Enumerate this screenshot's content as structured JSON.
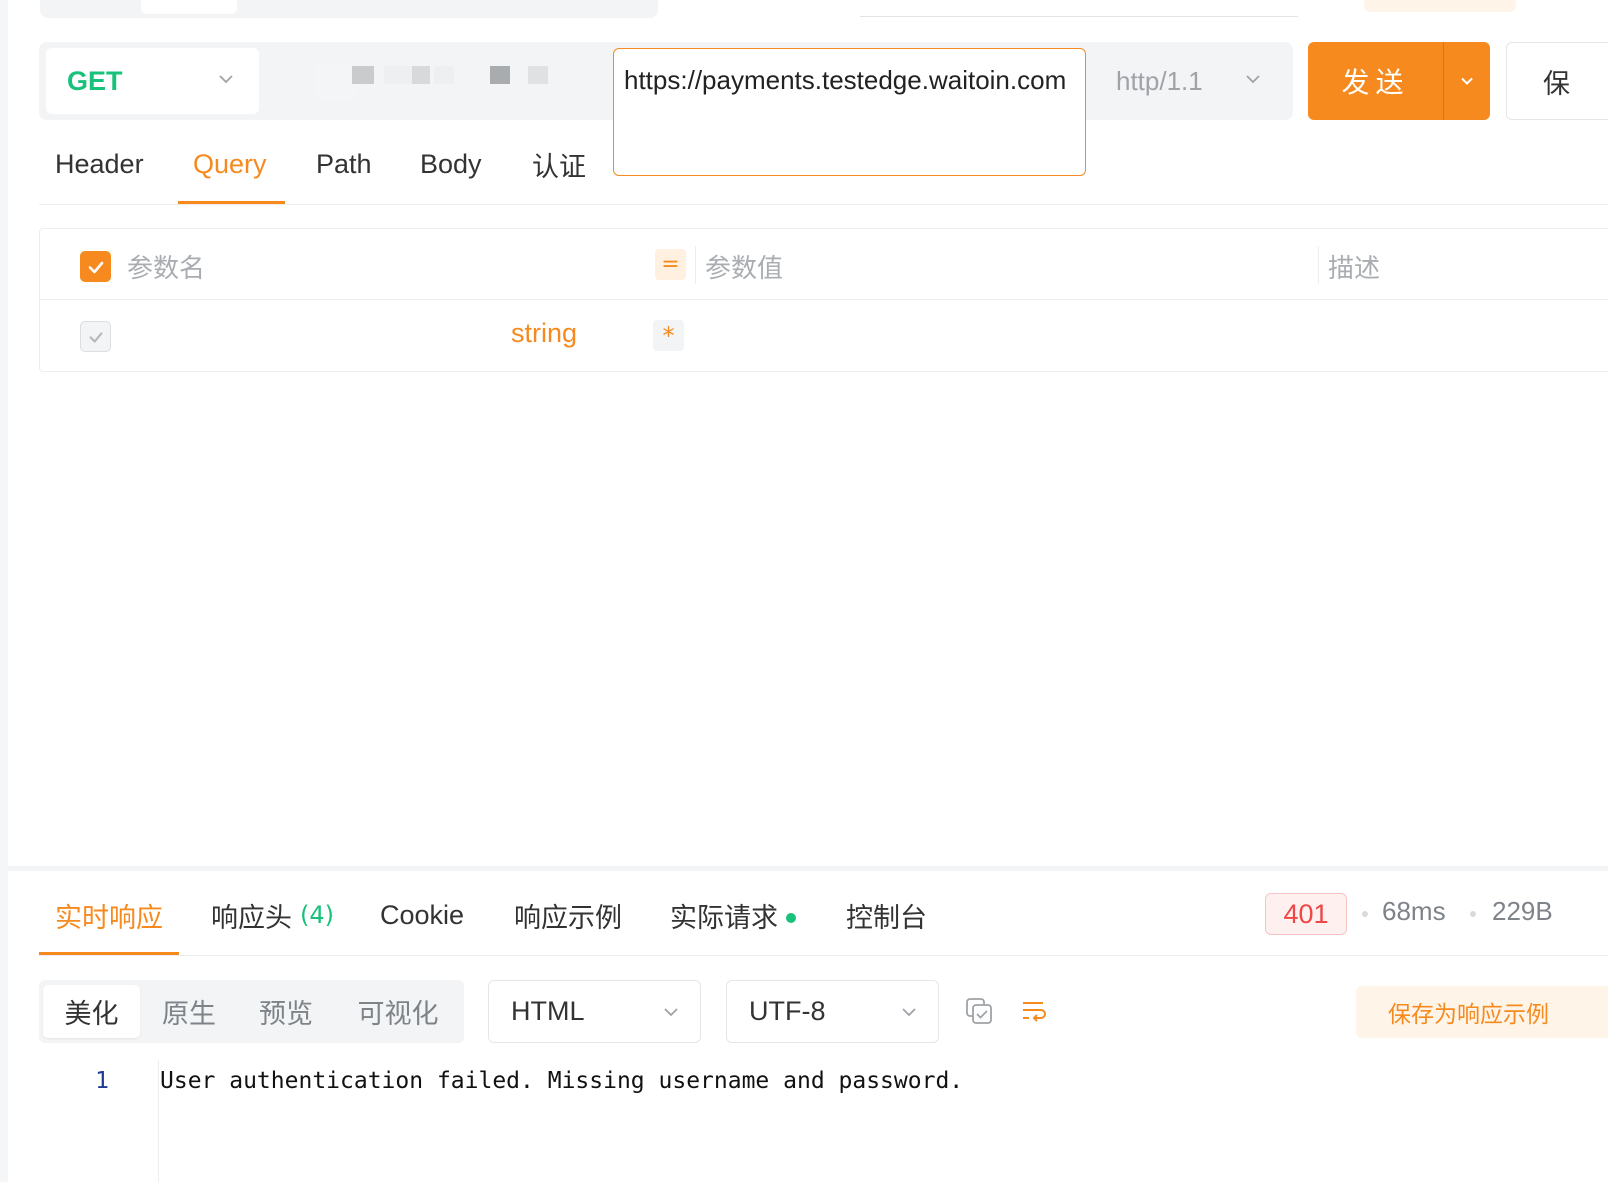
{
  "request": {
    "method": "GET",
    "url": "https://payments.testedge.waitoin.com",
    "protocol": "http/1.1",
    "send_label": "发送",
    "save_label": "保"
  },
  "request_tabs": [
    {
      "label": "Header",
      "active": false
    },
    {
      "label": "Query",
      "active": true
    },
    {
      "label": "Path",
      "active": false
    },
    {
      "label": "Body",
      "active": false
    },
    {
      "label": "认证",
      "active": false
    }
  ],
  "params": {
    "headers": {
      "name": "参数名",
      "equals": "=",
      "value": "参数值",
      "description": "描述"
    },
    "row": {
      "type": "string",
      "required_mark": "*"
    }
  },
  "response": {
    "tabs": [
      {
        "label": "实时响应",
        "active": true
      },
      {
        "label": "响应头",
        "count": "(4)"
      },
      {
        "label": "Cookie"
      },
      {
        "label": "响应示例"
      },
      {
        "label": "实际请求",
        "dot": true
      },
      {
        "label": "控制台"
      }
    ],
    "status": "401",
    "time": "68ms",
    "size": "229B",
    "view_modes": [
      "美化",
      "原生",
      "预览",
      "可视化"
    ],
    "format": "HTML",
    "encoding": "UTF-8",
    "save_example_label": "保存为响应示例",
    "line_number": "1",
    "body": "User authentication failed. Missing username and password."
  },
  "colors": {
    "accent": "#f68a1f",
    "method_get": "#19c27a",
    "status_error": "#f04646"
  },
  "icons": [
    "chevron-down-icon",
    "check-icon",
    "copy-icon",
    "wrap-lines-icon"
  ]
}
